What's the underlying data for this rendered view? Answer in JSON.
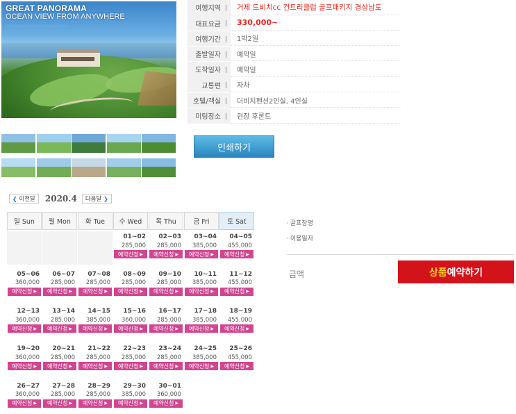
{
  "hero": {
    "title": "GREAT PANORAMA",
    "subtitle": "OCEAN VIEW FROM ANYWHERE"
  },
  "info": [
    {
      "label": "여행지역",
      "value": "거제 드비치cc 컨트리클럽 골프패키지 경상남도",
      "style": "red"
    },
    {
      "label": "대표요금",
      "value": "330,000~",
      "style": "price"
    },
    {
      "label": "여행기간",
      "value": "1박2일",
      "style": ""
    },
    {
      "label": "출발일자",
      "value": "예약일",
      "style": ""
    },
    {
      "label": "도착일자",
      "value": "예약일",
      "style": ""
    },
    {
      "label": "교통편",
      "value": "자차",
      "style": ""
    },
    {
      "label": "호텔/객실",
      "value": "더비치펜션2인실, 4인실",
      "style": ""
    },
    {
      "label": "미팅장소",
      "value": "현장 후론트",
      "style": ""
    }
  ],
  "thumbnails": [
    {
      "name": "thumb-1",
      "sky": "#8fc1e6",
      "land": "#5f9a44"
    },
    {
      "name": "thumb-2",
      "sky": "#9ecfee",
      "land": "#7bb85a"
    },
    {
      "name": "thumb-3",
      "sky": "#6fa7d6",
      "land": "#3f7b3a"
    },
    {
      "name": "thumb-4",
      "sky": "#a7d5f0",
      "land": "#6aa84f"
    },
    {
      "name": "thumb-5",
      "sky": "#7fb7e2",
      "land": "#4c8d33"
    },
    {
      "name": "thumb-6",
      "sky": "#b6dcf2",
      "land": "#86bd66"
    },
    {
      "name": "thumb-7",
      "sky": "#9fcbe9",
      "land": "#72ad55"
    },
    {
      "name": "thumb-8",
      "sky": "#c4d8e6",
      "land": "#b9a88a"
    },
    {
      "name": "thumb-9",
      "sky": "#a1cde8",
      "land": "#77b060"
    },
    {
      "name": "thumb-10",
      "sky": "#88bde3",
      "land": "#4f8f3a"
    }
  ],
  "print_button": "인쇄하기",
  "calendar": {
    "prev_label": "이전달",
    "next_label": "다음달",
    "month": "2020.4",
    "weekdays": [
      "일 Sun",
      "월 Mon",
      "화 Tue",
      "수 Wed",
      "목 Thu",
      "금 Fri",
      "토 Sat"
    ],
    "button_label": "예약신청",
    "weeks": [
      [
        null,
        null,
        null,
        {
          "date": "01~02",
          "price": "285,000"
        },
        {
          "date": "02~03",
          "price": "285,000"
        },
        {
          "date": "03~04",
          "price": "385,000"
        },
        {
          "date": "04~05",
          "price": "455,000"
        }
      ],
      [
        {
          "date": "05~06",
          "price": "360,000"
        },
        {
          "date": "06~07",
          "price": "285,000"
        },
        {
          "date": "07~08",
          "price": "285,000"
        },
        {
          "date": "08~09",
          "price": "285,000"
        },
        {
          "date": "09~10",
          "price": "285,000"
        },
        {
          "date": "10~11",
          "price": "385,000"
        },
        {
          "date": "11~12",
          "price": "455,000"
        }
      ],
      [
        {
          "date": "12~13",
          "price": "360,000"
        },
        {
          "date": "13~14",
          "price": "285,000"
        },
        {
          "date": "14~15",
          "price": "385,000"
        },
        {
          "date": "15~16",
          "price": "360,000"
        },
        {
          "date": "16~17",
          "price": "285,000"
        },
        {
          "date": "17~18",
          "price": "385,000"
        },
        {
          "date": "18~19",
          "price": "455,000"
        }
      ],
      [
        {
          "date": "19~20",
          "price": "360,000"
        },
        {
          "date": "20~21",
          "price": "285,000"
        },
        {
          "date": "21~22",
          "price": "285,000"
        },
        {
          "date": "22~23",
          "price": "285,000"
        },
        {
          "date": "23~24",
          "price": "285,000"
        },
        {
          "date": "24~25",
          "price": "385,000"
        },
        {
          "date": "25~26",
          "price": "455,000"
        }
      ],
      [
        {
          "date": "26~27",
          "price": "360,000"
        },
        {
          "date": "27~28",
          "price": "285,000"
        },
        {
          "date": "28~29",
          "price": "285,000"
        },
        {
          "date": "29~30",
          "price": "385,000"
        },
        {
          "date": "30~01",
          "price": "360,000"
        },
        null,
        null
      ]
    ]
  },
  "right_panel": {
    "golf_course_label": "골프장명",
    "use_date_label": "이용일자",
    "amount_label": "금액",
    "book_button_highlight": "상품",
    "book_button_rest": "예약하기"
  }
}
